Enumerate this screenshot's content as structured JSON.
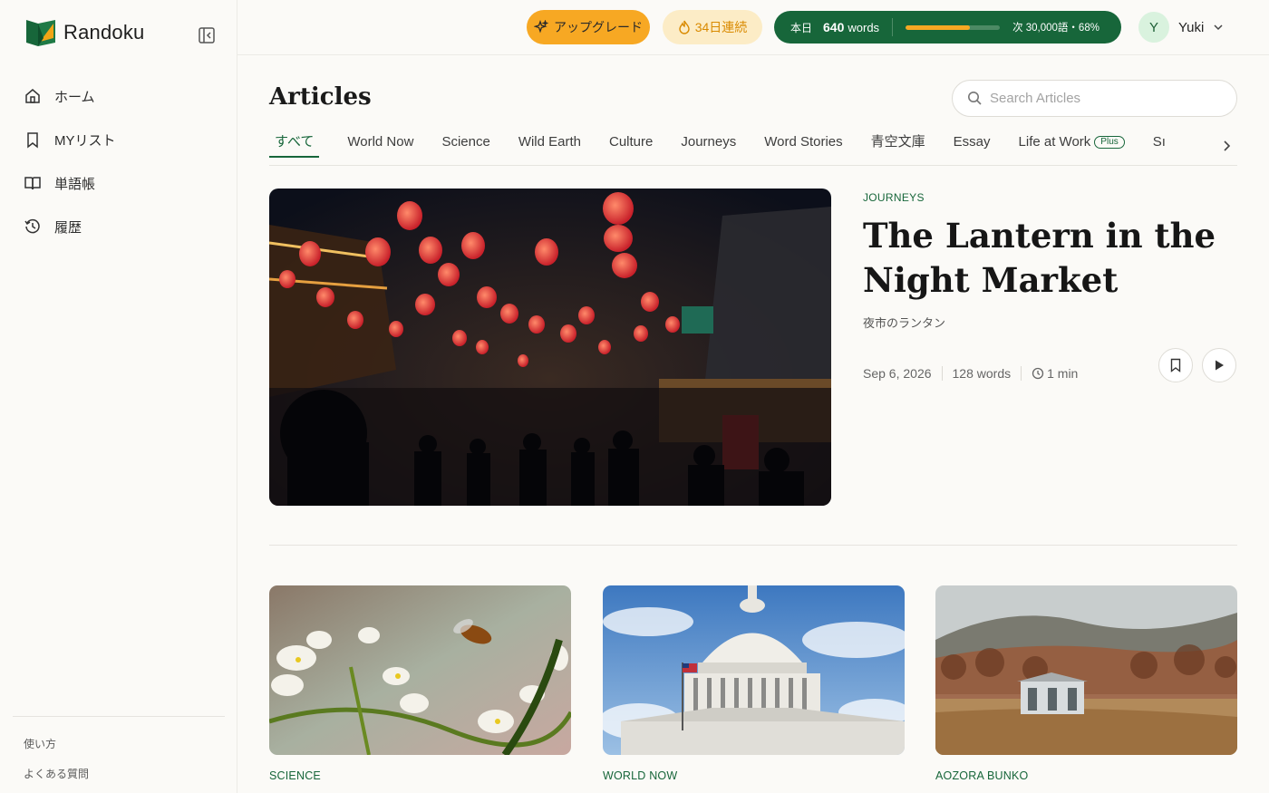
{
  "app": {
    "name": "Randoku"
  },
  "sidebar": {
    "items": [
      {
        "label": "ホーム",
        "icon": "home-icon"
      },
      {
        "label": "MYリスト",
        "icon": "bookmark-icon"
      },
      {
        "label": "単語帳",
        "icon": "book-icon"
      },
      {
        "label": "履歴",
        "icon": "history-icon"
      }
    ],
    "footer": [
      {
        "label": "使い方"
      },
      {
        "label": "よくある質問"
      }
    ]
  },
  "topbar": {
    "upgrade_label": "アップグレード",
    "streak_label": "34日連続",
    "progress": {
      "today_label": "本日",
      "count": "640",
      "unit": "words",
      "next_label": "次 30,000語・68%",
      "fraction": 0.68
    },
    "user": {
      "initial": "Y",
      "name": "Yuki"
    }
  },
  "main": {
    "title": "Articles",
    "search": {
      "placeholder": "Search Articles"
    },
    "tabs": [
      {
        "label": "すべて",
        "active": true
      },
      {
        "label": "World Now"
      },
      {
        "label": "Science"
      },
      {
        "label": "Wild Earth"
      },
      {
        "label": "Culture"
      },
      {
        "label": "Journeys"
      },
      {
        "label": "Word Stories"
      },
      {
        "label": "青空文庫"
      },
      {
        "label": "Essay"
      },
      {
        "label": "Life at Work",
        "badge": "Plus"
      },
      {
        "label": "Sı"
      }
    ],
    "hero": {
      "category": "JOURNEYS",
      "title": "The Lantern in the Night Market",
      "subtitle": "夜市のランタン",
      "date": "Sep 6, 2026",
      "words": "128 words",
      "duration": "1 min"
    },
    "cards": [
      {
        "category": "SCIENCE"
      },
      {
        "category": "WORLD NOW"
      },
      {
        "category": "AOZORA BUNKO"
      }
    ]
  },
  "colors": {
    "brand_green": "#17663a",
    "accent_orange": "#f7a823",
    "streak_bg": "#fcecc6"
  }
}
